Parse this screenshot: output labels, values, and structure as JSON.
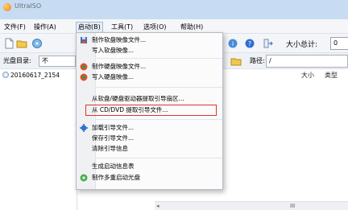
{
  "window": {
    "title": "UltraISO"
  },
  "menubar": {
    "items": [
      "文件(F)",
      "操作(A)",
      "启动(B)",
      "工具(T)",
      "选项(O)",
      "帮助(H)"
    ]
  },
  "toolbar": {
    "total_size_label": "大小总计:",
    "total_size_value": "0"
  },
  "disc": {
    "label": "光盘目录:",
    "value": "不",
    "path_label": "路径:",
    "path_value": "/"
  },
  "tree": {
    "item": "20160617_2154"
  },
  "file_list": {
    "columns": [
      "大小",
      "类型"
    ]
  },
  "scrollbar": {
    "left_arrow": "◂",
    "grip": "III"
  },
  "boot_menu": {
    "items": [
      "制作软盘映像文件...",
      "写入软盘映像...",
      "制作硬盘映像文件...",
      "写入硬盘映像...",
      "从软盘/硬盘驱动器提取引导扇区...",
      "从 CD/DVD 提取引导文件...",
      "加载引导文件...",
      "保存引导文件...",
      "清除引导信息",
      "生成启动信息表",
      "制作多重启动光盘"
    ],
    "highlighted_color": "#e0332f"
  }
}
